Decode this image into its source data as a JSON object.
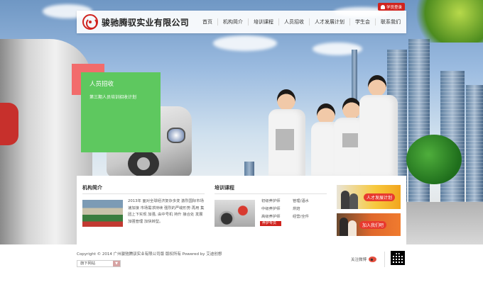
{
  "brand": {
    "name": "骏驰腾驭实业有限公司"
  },
  "topbar": {
    "login_label": "学员登录"
  },
  "nav": {
    "items": [
      {
        "label": "首页"
      },
      {
        "label": "机构简介"
      },
      {
        "label": "培训课程"
      },
      {
        "label": "人员招收"
      },
      {
        "label": "人才发展计划"
      },
      {
        "label": "学生会"
      },
      {
        "label": "联系我们"
      }
    ]
  },
  "hero_card": {
    "title": "人员招收",
    "subtitle": "第三期人员培训招收计划"
  },
  "about": {
    "title": "机构简介",
    "text": "2013年 面对全球经济复杂多变 激烈国际市场 速加接 市场需求持续 强烈的严峻形势 再用 集团上下实现 加强, 由中号机 持升 接合处 发展 加强管理 加快转型。"
  },
  "courses": {
    "title": "培训课程",
    "col1": [
      "初级养护师",
      "中级养护师",
      "高级养护师"
    ],
    "col2": [
      "管理/酒水",
      "烘焙",
      "经营/全件"
    ],
    "tag": "养护专员"
  },
  "promos": [
    {
      "label": "人才发展计划"
    },
    {
      "label": "加入我们吧"
    }
  ],
  "footer": {
    "copyright": "Copyright © 2014 广州骏驰腾驭实业有限公司版 版权所有  Powered by 艾迪创想",
    "select_value": "旗下网站",
    "weibo_label": "关注微博"
  }
}
